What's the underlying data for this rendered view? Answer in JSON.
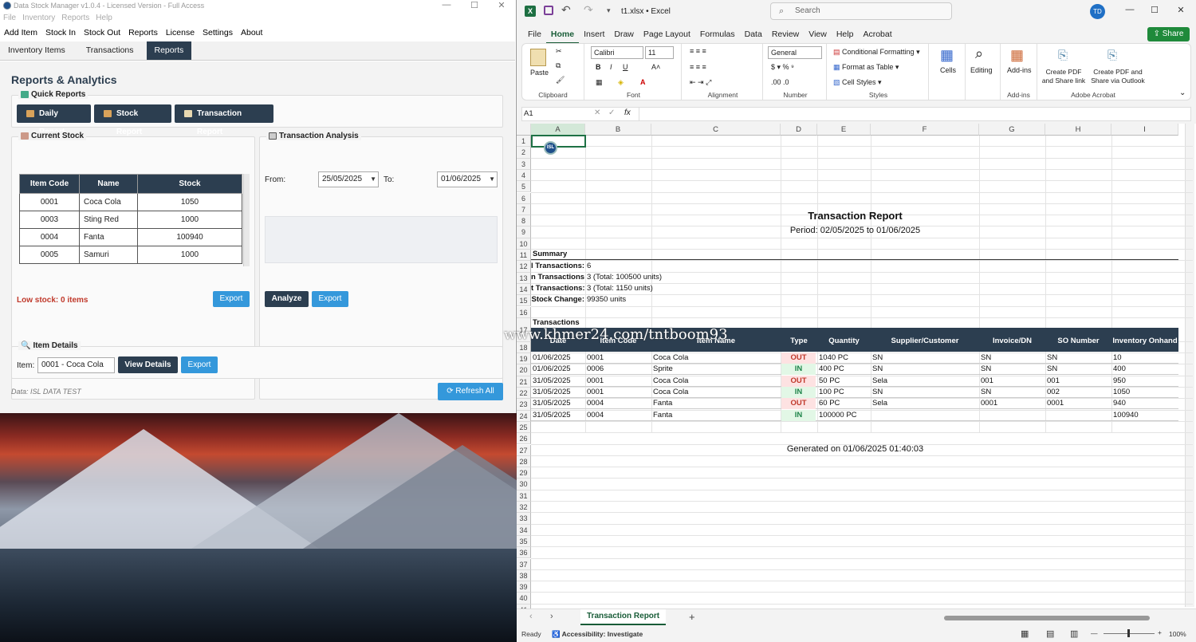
{
  "app": {
    "title": "Data Stock Manager v1.0.4 - Licensed Version - Full Access",
    "menu_top": [
      "File",
      "Inventory",
      "Reports",
      "Help"
    ],
    "menu_main": [
      "Add Item",
      "Stock In",
      "Stock Out",
      "Reports",
      "License",
      "Settings",
      "About"
    ],
    "tabs": [
      "Inventory Items",
      "Transactions",
      "Reports"
    ],
    "active_tab": "Reports",
    "heading": "Reports & Analytics",
    "quick_reports": {
      "label": "Quick Reports",
      "buttons": [
        "Daily Report",
        "Stock Report",
        "Transaction Report"
      ]
    },
    "current_stock": {
      "label": "Current Stock",
      "columns": [
        "Item Code",
        "Name",
        "Stock"
      ],
      "rows": [
        [
          "0001",
          "Coca Cola",
          "1050"
        ],
        [
          "0003",
          "Sting Red",
          "1000"
        ],
        [
          "0004",
          "Fanta",
          "100940"
        ],
        [
          "0005",
          "Samuri",
          "1000"
        ]
      ],
      "low_stock": "Low stock: 0 items",
      "export_label": "Export"
    },
    "transaction_analysis": {
      "label": "Transaction Analysis",
      "from_label": "From:",
      "from_value": "25/05/2025",
      "to_label": "To:",
      "to_value": "01/06/2025",
      "analyze_label": "Analyze",
      "export_label": "Export"
    },
    "item_details": {
      "label": "Item Details",
      "item_label": "Item:",
      "item_value": "0001 - Coca Cola",
      "view_label": "View Details",
      "export_label": "Export"
    },
    "footer_data": "Data: ISL DATA TEST",
    "refresh_label": "Refresh All"
  },
  "excel": {
    "filename": "t1.xlsx",
    "app_name": "Excel",
    "search_placeholder": "Search",
    "user_initials": "TD",
    "share_label": "Share",
    "ribbon_tabs": [
      "File",
      "Home",
      "Insert",
      "Draw",
      "Page Layout",
      "Formulas",
      "Data",
      "Review",
      "View",
      "Help",
      "Acrobat"
    ],
    "active_ribbon_tab": "Home",
    "font_name": "Calibri",
    "font_size": "11",
    "number_format": "General",
    "groups": {
      "clipboard": "Clipboard",
      "font": "Font",
      "alignment": "Alignment",
      "number": "Number",
      "styles": "Styles",
      "addins": "Add-ins",
      "acrobat": "Adobe Acrobat"
    },
    "paste_label": "Paste",
    "cond_format": "Conditional Formatting",
    "format_table": "Format as Table",
    "cell_styles": "Cell Styles",
    "cells_label": "Cells",
    "editing_label": "Editing",
    "addins_label": "Add-ins",
    "acrobat_1": "Create PDF and Share link",
    "acrobat_2": "Create PDF and Share via Outlook",
    "name_box": "A1",
    "fx": "fx",
    "columns": [
      "A",
      "B",
      "C",
      "D",
      "E",
      "F",
      "G",
      "H",
      "I"
    ],
    "report_title": "Transaction Report",
    "period": "Period: 02/05/2025 to 01/06/2025",
    "summary_label": "Summary",
    "summary": [
      [
        "l Transactions:",
        "6"
      ],
      [
        "n Transactions:",
        "3 (Total: 100500 units)"
      ],
      [
        "t Transactions:",
        "3 (Total: 1150 units)"
      ],
      [
        "Stock Change:",
        "99350 units"
      ]
    ],
    "transactions_label": "Transactions",
    "table_headers": [
      "Date",
      "Item Code",
      "Item Name",
      "Type",
      "Quantity",
      "Supplier/Customer",
      "Invoice/DN",
      "SO Number",
      "Inventory Onhand"
    ],
    "table_rows": [
      [
        "01/06/2025",
        "0001",
        "Coca Cola",
        "OUT",
        "1040 PC",
        "SN",
        "SN",
        "SN",
        "10"
      ],
      [
        "01/06/2025",
        "0006",
        "Sprite",
        "IN",
        "400 PC",
        "SN",
        "SN",
        "SN",
        "400"
      ],
      [
        "31/05/2025",
        "0001",
        "Coca Cola",
        "OUT",
        "50 PC",
        "Sela",
        "001",
        "001",
        "950"
      ],
      [
        "31/05/2025",
        "0001",
        "Coca Cola",
        "IN",
        "100 PC",
        "SN",
        "SN",
        "002",
        "1050"
      ],
      [
        "31/05/2025",
        "0004",
        "Fanta",
        "OUT",
        "60 PC",
        "Sela",
        "0001",
        "0001",
        "940"
      ],
      [
        "31/05/2025",
        "0004",
        "Fanta",
        "IN",
        "100000 PC",
        "",
        "",
        "",
        "100940"
      ]
    ],
    "generated": "Generated on 01/06/2025 01:40:03",
    "sheet_tab": "Transaction Report",
    "status_ready": "Ready",
    "status_access": "Accessibility: Investigate",
    "zoom": "100%"
  },
  "watermark": "www.khmer24.com/tntboom93"
}
